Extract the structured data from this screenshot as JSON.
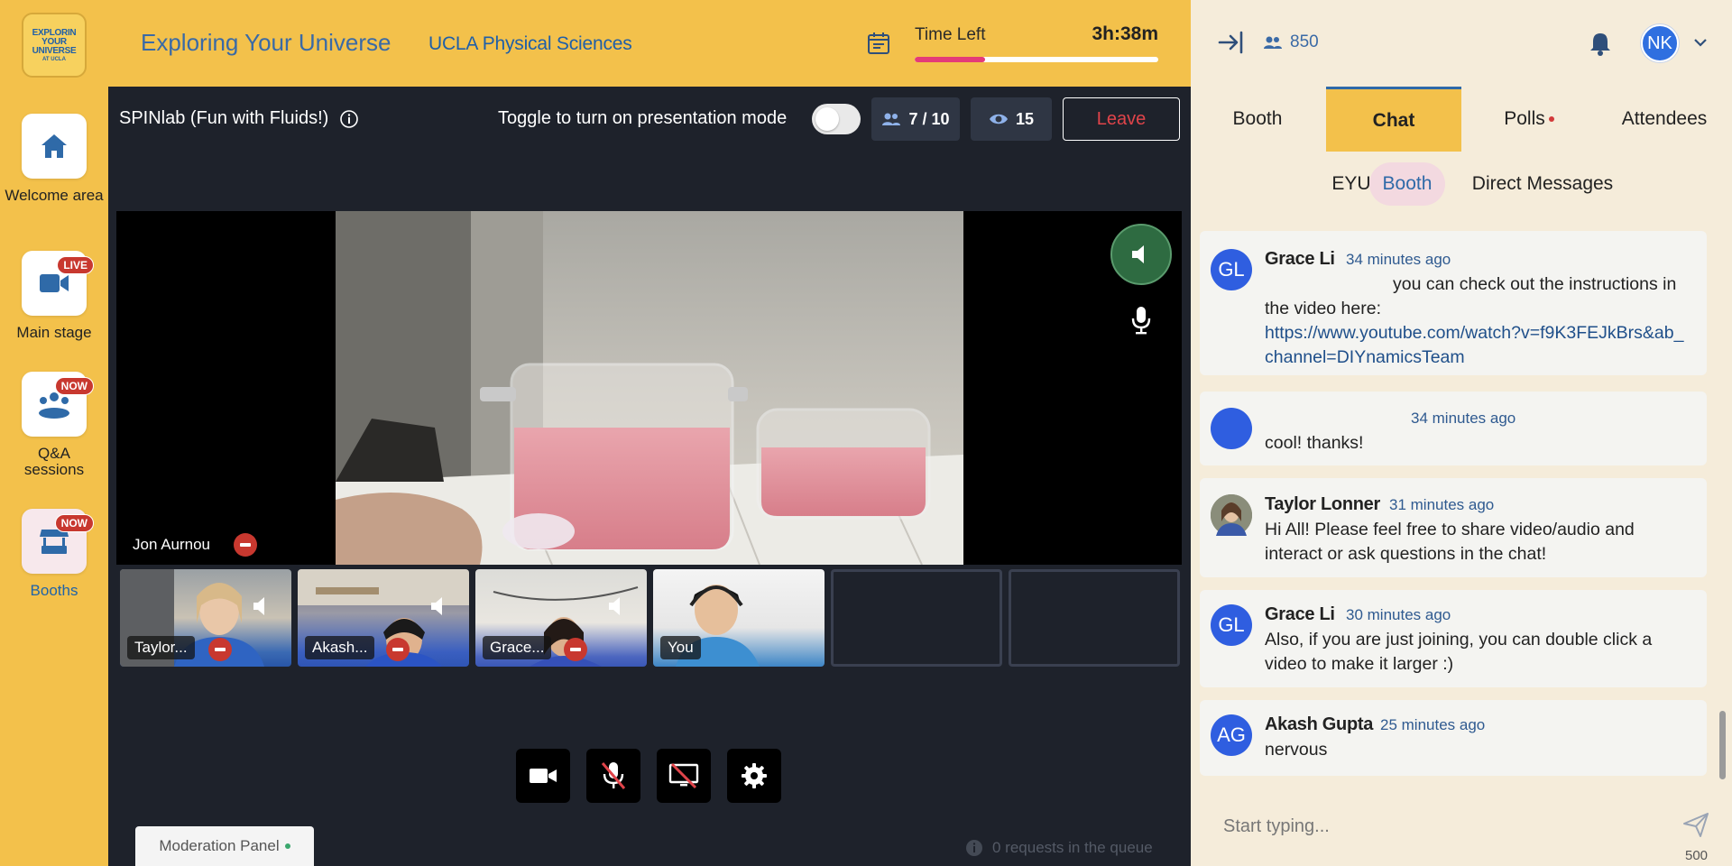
{
  "sidebar": {
    "logo_lines": [
      "EXPLORIN",
      "YOUR",
      "UNIVERSE"
    ],
    "logo_small": "AT UCLA",
    "items": [
      {
        "label": "Welcome area",
        "icon": "home-icon",
        "badge": ""
      },
      {
        "label": "Main stage",
        "icon": "camera-icon",
        "badge": "LIVE"
      },
      {
        "label": "Q&A sessions",
        "icon": "audience-icon",
        "badge": "NOW"
      },
      {
        "label": "Booths",
        "icon": "booth-icon",
        "badge": "NOW"
      }
    ]
  },
  "header": {
    "event_title": "Exploring Your Universe",
    "org_name": "UCLA Physical Sciences",
    "time_left_label": "Time Left",
    "time_left_value": "3h:38m",
    "time_progress": 0.29,
    "colors": {
      "background": "#f3c14b",
      "progress": "#e43b78"
    }
  },
  "session": {
    "title": "SPINlab (Fun with Fluids!)",
    "presentation_label": "Toggle to turn on presentation mode",
    "presentation_on": false,
    "participants": "7 / 10",
    "viewers": "15",
    "leave_label": "Leave"
  },
  "video": {
    "main_speaker": "Jon Aurnou",
    "thumbnails": [
      {
        "name": "Taylor...",
        "empty": false,
        "remove": true
      },
      {
        "name": "Akash...",
        "empty": false,
        "remove": true
      },
      {
        "name": "Grace...",
        "empty": false,
        "remove": true
      },
      {
        "name": "You",
        "empty": false,
        "remove": false
      },
      {
        "name": "",
        "empty": true,
        "remove": false
      },
      {
        "name": "",
        "empty": true,
        "remove": false
      }
    ],
    "controls": [
      "video-camera-icon",
      "mic-muted-icon",
      "screen-share-off-icon",
      "settings-gear-icon"
    ]
  },
  "moderation": {
    "tab_label": "Moderation Panel",
    "queue_status": "0 requests in the queue"
  },
  "right_panel": {
    "attendee_count": "850",
    "avatar_initials": "NK",
    "tabs": [
      {
        "label": "Booth",
        "active": false,
        "dot": false
      },
      {
        "label": "Chat",
        "active": true,
        "dot": false
      },
      {
        "label": "Polls",
        "active": false,
        "dot": true
      },
      {
        "label": "Attendees",
        "active": false,
        "dot": false
      }
    ],
    "sub_tabs": [
      {
        "label": "EYU",
        "active": false
      },
      {
        "label": "Booth",
        "active": true
      },
      {
        "label": "Direct Messages",
        "active": false
      }
    ],
    "messages": [
      {
        "author": "Grace Li",
        "initials": "GL",
        "time": "34 minutes ago",
        "text": "you can check out the instructions in the video here:",
        "link": "https://www.youtube.com/watch?v=f9K3FEJkBrs&ab_channel=DIYnamicsTeam"
      },
      {
        "author": "",
        "initials": "",
        "time": "34 minutes ago",
        "text": "cool! thanks!",
        "link": ""
      },
      {
        "author": "Taylor Lonner",
        "initials": "",
        "time": "31 minutes ago",
        "text": "Hi All! Please feel free to share video/audio and interact or ask questions in the chat!",
        "link": ""
      },
      {
        "author": "Grace Li",
        "initials": "GL",
        "time": "30 minutes ago",
        "text": "Also, if you are just joining, you can double click a video to make it larger :)",
        "link": ""
      },
      {
        "author": "Akash Gupta",
        "initials": "AG",
        "time": "25 minutes ago",
        "text": "nervous",
        "link": ""
      }
    ],
    "composer_placeholder": "Start typing...",
    "char_limit": "500",
    "colors": {
      "panel": "#f5ecda",
      "accent_blue": "#2f6aa8",
      "avatar_blue": "#2f5ee0"
    }
  }
}
